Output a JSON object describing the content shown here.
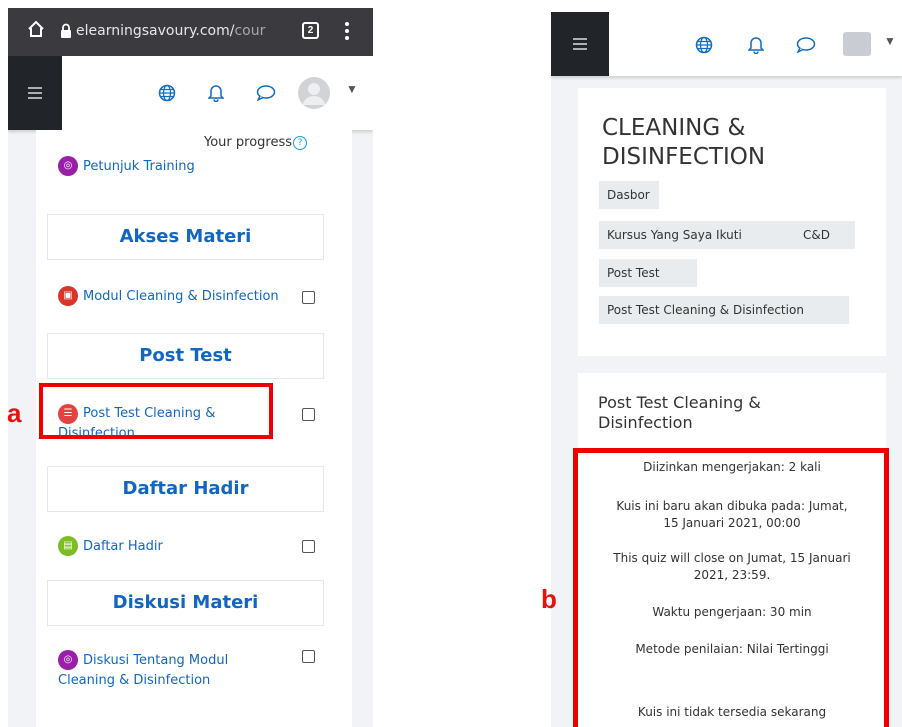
{
  "left_screen": {
    "browser": {
      "home_icon": "home-icon",
      "lock_icon": "lock-icon",
      "url_host": "elearningsavoury.com/",
      "url_path": "cour",
      "tab_count": "2",
      "menu_icon": "kebab-icon"
    },
    "navbar": {
      "menu_icon": "hamburger-icon",
      "icons": [
        "globe-icon",
        "bell-icon",
        "chat-icon",
        "user-avatar"
      ]
    },
    "progress_label": "Your progress",
    "activities": {
      "petunjuk": "Petunjuk Training",
      "modul": "Modul Cleaning & Disinfection",
      "post_test_line1": "Post Test Cleaning &",
      "post_test_line2": "Disinfection",
      "daftar_hadir": "Daftar Hadir",
      "diskusi_line1": "Diskusi Tentang Modul",
      "diskusi_line2": "Cleaning & Disinfection"
    },
    "sections": {
      "akses": "Akses Materi",
      "post_test": "Post Test",
      "daftar_hadir": "Daftar Hadir",
      "diskusi": "Diskusi Materi"
    }
  },
  "annotation_labels": {
    "a": "a",
    "b": "b"
  },
  "right_screen": {
    "course_title_line1": "CLEANING &",
    "course_title_line2": "DISINFECTION",
    "breadcrumbs": {
      "dasbor": "Dasbor",
      "kursus": "Kursus Yang Saya Ikuti",
      "cd": "C&D",
      "post_test": "Post Test",
      "post_test_full": "Post Test Cleaning & Disinfection"
    },
    "quiz": {
      "title_line1": "Post Test Cleaning &",
      "title_line2": "Disinfection",
      "attempts": "Diizinkan mengerjakan: 2 kali",
      "opens_line1": "Kuis ini baru akan dibuka pada: Jumat,",
      "opens_line2": "15 Januari 2021, 00:00",
      "closes_line1": "This quiz will close on Jumat, 15 Januari",
      "closes_line2": "2021, 23:59.",
      "time_limit": "Waktu pengerjaan: 30 min",
      "grading": "Metode penilaian: Nilai Tertinggi",
      "unavailable": "Kuis ini tidak tersedia sekarang"
    }
  },
  "colors": {
    "moodle_blue": "#1266c2",
    "annotation_red": "#ee0000",
    "forum_purple": "#9a1fa8",
    "pdf_red": "#d9352a",
    "quiz_red": "#e34242",
    "attendance_green": "#7bbd22"
  }
}
